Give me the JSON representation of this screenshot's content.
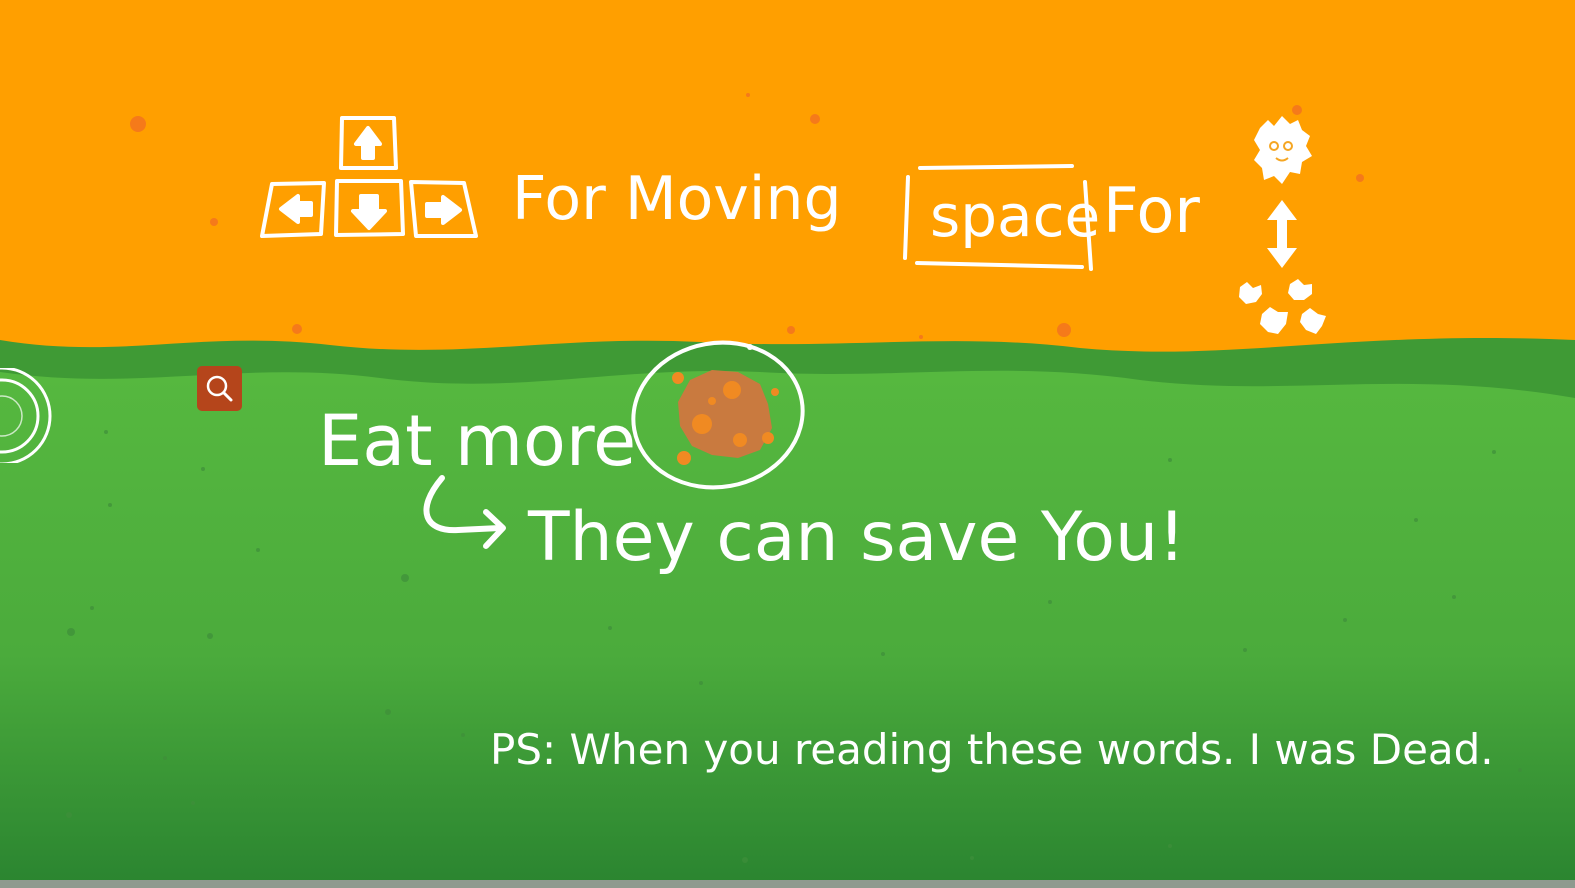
{
  "colors": {
    "sky": "#ff9f00",
    "grass_light": "#54b53e",
    "grass_dark": "#2f8a30",
    "ink": "#ffffff",
    "search_button": "#b5451b",
    "food": "#e07a2a"
  },
  "instructions": {
    "move_text": "For Moving",
    "space_key": "space",
    "space_text": "For",
    "eat_text": "Eat more",
    "save_text": "They can save You!",
    "ps_text": "PS: When you reading these words. I was Dead."
  },
  "icons": {
    "arrow_keys": [
      "arrow-left-key-icon",
      "arrow-up-key-icon",
      "arrow-down-key-icon",
      "arrow-right-key-icon"
    ],
    "search": "search-icon",
    "food": "orange-blob-food-icon",
    "character": "spiky-creature-icon",
    "vertical_arrow": "up-down-arrow-icon",
    "creatures": "small-creatures-icon",
    "ring": "concentric-ring-icon"
  }
}
